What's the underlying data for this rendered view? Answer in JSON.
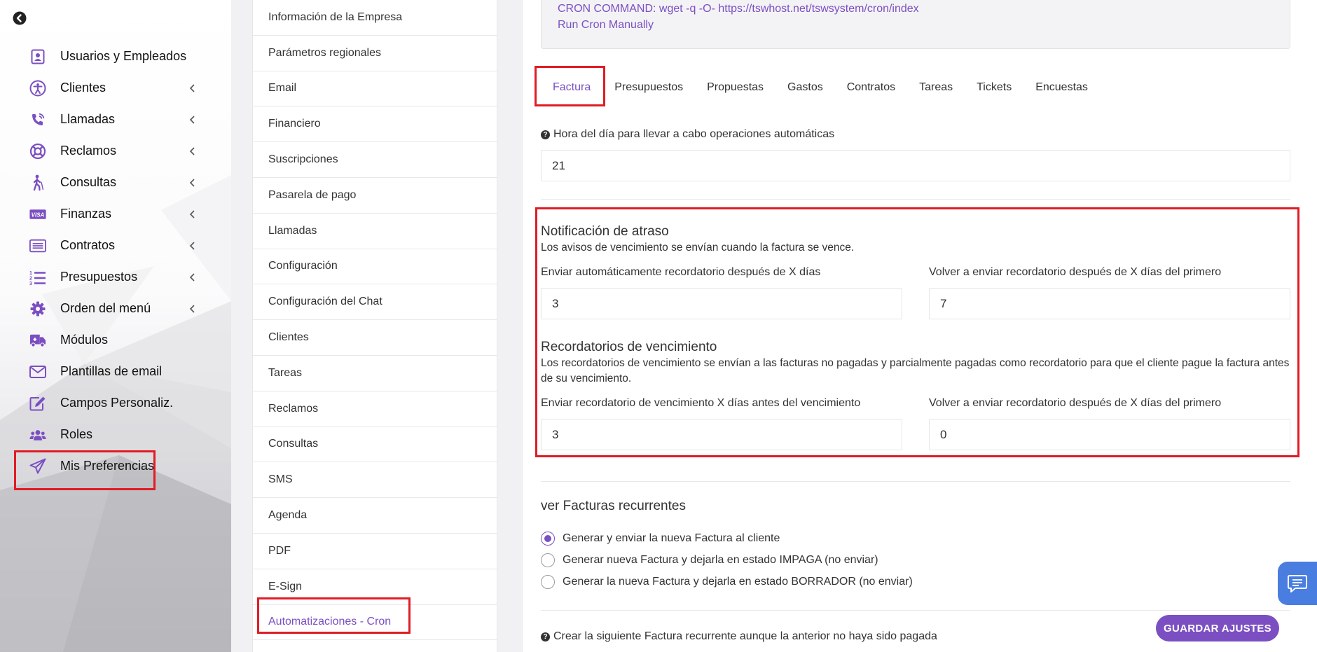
{
  "sidebar": {
    "items": [
      {
        "label": "Usuarios y Empleados",
        "icon": "contact-card-icon",
        "has_submenu": false
      },
      {
        "label": "Clientes",
        "icon": "accessibility-icon",
        "has_submenu": true
      },
      {
        "label": "Llamadas",
        "icon": "phone-ringing-icon",
        "has_submenu": true
      },
      {
        "label": "Reclamos",
        "icon": "lifebuoy-icon",
        "has_submenu": true
      },
      {
        "label": "Consultas",
        "icon": "walking-person-icon",
        "has_submenu": true
      },
      {
        "label": "Finanzas",
        "icon": "visa-card-icon",
        "has_submenu": true
      },
      {
        "label": "Contratos",
        "icon": "list-doc-icon",
        "has_submenu": true
      },
      {
        "label": "Presupuestos",
        "icon": "numbered-list-icon",
        "has_submenu": true
      },
      {
        "label": "Orden del menú",
        "icon": "gear-icon",
        "has_submenu": true
      },
      {
        "label": "Módulos",
        "icon": "ambulance-icon",
        "has_submenu": false
      },
      {
        "label": "Plantillas de email",
        "icon": "envelope-icon",
        "has_submenu": false
      },
      {
        "label": "Campos Personaliz.",
        "icon": "edit-icon",
        "has_submenu": false
      },
      {
        "label": "Roles",
        "icon": "users-icon",
        "has_submenu": false
      },
      {
        "label": "Mis Preferencias",
        "icon": "paper-plane-icon",
        "has_submenu": false
      }
    ],
    "visa_text": "VISA"
  },
  "settings_menu": {
    "items": [
      "Información de la Empresa",
      "Parámetros regionales",
      "Email",
      "Financiero",
      "Suscripciones",
      "Pasarela de pago",
      "Llamadas",
      "Configuración",
      "Configuración del Chat",
      "Clientes",
      "Tareas",
      "Reclamos",
      "Consultas",
      "SMS",
      "Agenda",
      "PDF",
      "E-Sign",
      "Automatizaciones - Cron"
    ],
    "active_index": 17
  },
  "cron": {
    "command": "CRON COMMAND: wget -q -O- https://tswhost.net/tswsystem/cron/index",
    "run_manually": "Run Cron Manually"
  },
  "tabs": [
    "Factura",
    "Presupuestos",
    "Propuestas",
    "Gastos",
    "Contratos",
    "Tareas",
    "Tickets",
    "Encuestas"
  ],
  "active_tab": 0,
  "hour": {
    "label": "Hora del día para llevar a cabo operaciones automáticas",
    "value": "21"
  },
  "overdue": {
    "title": "Notificación de atraso",
    "subtitle": "Los avisos de vencimiento se envían cuando la factura se vence.",
    "auto_label": "Enviar automáticamente recordatorio después de X días",
    "auto_value": "3",
    "resend_label": "Volver a enviar recordatorio después de X días del primero",
    "resend_value": "7"
  },
  "due": {
    "title": "Recordatorios de vencimiento",
    "subtitle": "Los recordatorios de vencimiento se envían a las facturas no pagadas y parcialmente pagadas como recordatorio para que el cliente pague la factura antes de su vencimiento.",
    "before_label": "Enviar recordatorio de vencimiento X días antes del vencimiento",
    "before_value": "3",
    "resend_label": "Volver a enviar recordatorio después de X días del primero",
    "resend_value": "0"
  },
  "recurring": {
    "title": "ver Facturas recurrentes",
    "options": [
      "Generar y enviar la nueva Factura al cliente",
      "Generar nueva Factura y dejarla en estado IMPAGA (no enviar)",
      "Generar la nueva Factura y dejarla en estado BORRADOR (no enviar)"
    ],
    "selected_index": 0,
    "create_next_label": "Crear la siguiente Factura recurrente aunque la anterior no haya sido pagada"
  },
  "save_button": "GUARDAR AJUSTES",
  "colors": {
    "accent": "#7b4fc2",
    "highlight": "#e01c24",
    "chat": "#4a7de0"
  }
}
